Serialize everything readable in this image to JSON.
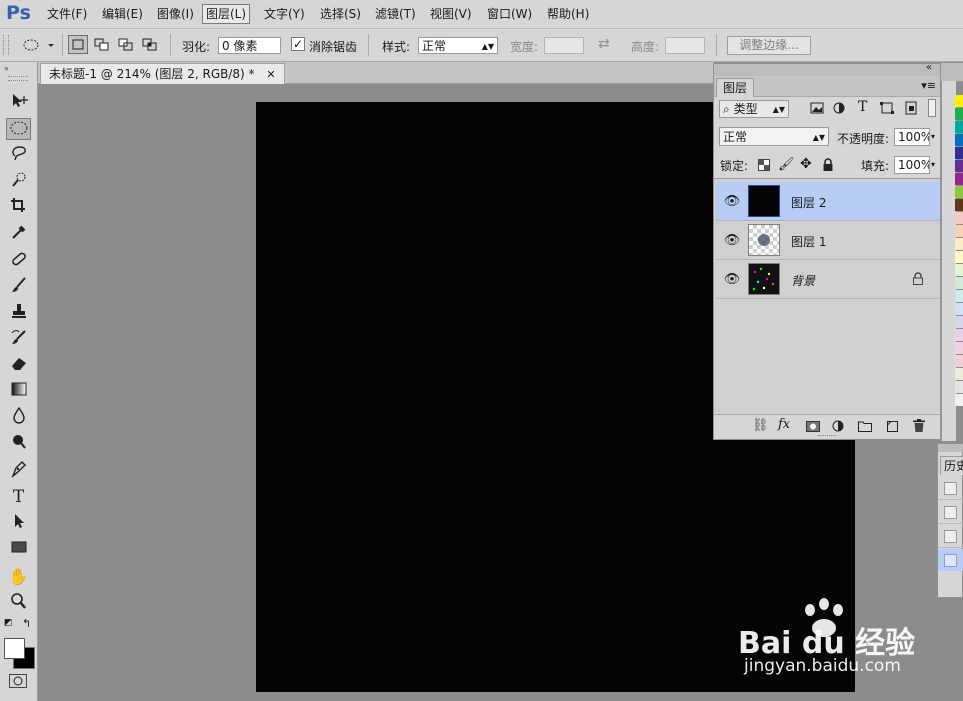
{
  "app": {
    "logo": "Ps"
  },
  "menu": [
    "文件(F)",
    "编辑(E)",
    "图像(I)",
    "图层(L)",
    "文字(Y)",
    "选择(S)",
    "滤镜(T)",
    "视图(V)",
    "窗口(W)",
    "帮助(H)"
  ],
  "active_menu_index": 3,
  "options": {
    "feather_label": "羽化:",
    "feather_value": "0 像素",
    "antialias_label": "消除锯齿",
    "antialias_checked": true,
    "style_label": "样式:",
    "style_value": "正常",
    "width_label": "宽度:",
    "height_label": "高度:",
    "refine_button": "调整边缘..."
  },
  "document": {
    "tab_title": "未标题-1 @ 214% (图层 2, RGB/8) *",
    "canvas_color": "#050305"
  },
  "layers_panel": {
    "tab_label": "图层",
    "filter_label": "类型",
    "blend_mode": "正常",
    "opacity_label": "不透明度:",
    "opacity_value": "100%",
    "lock_label": "锁定:",
    "fill_label": "填充:",
    "fill_value": "100%",
    "layers": [
      {
        "name": "图层 2",
        "selected": true,
        "italic": false,
        "locked": false
      },
      {
        "name": "图层 1",
        "selected": false,
        "italic": false,
        "locked": false
      },
      {
        "name": "背景",
        "selected": false,
        "italic": true,
        "locked": true
      }
    ]
  },
  "history_panel": {
    "tab_label": "历史"
  },
  "watermark": {
    "line1": "Bai du 经验",
    "line2": "jingyan.baidu.com"
  },
  "colors": {
    "accent_selection": "#b7cdf5",
    "chrome": "#d6d6d6",
    "workspace": "#8c8c8c",
    "logo_blue": "#3162b6"
  }
}
